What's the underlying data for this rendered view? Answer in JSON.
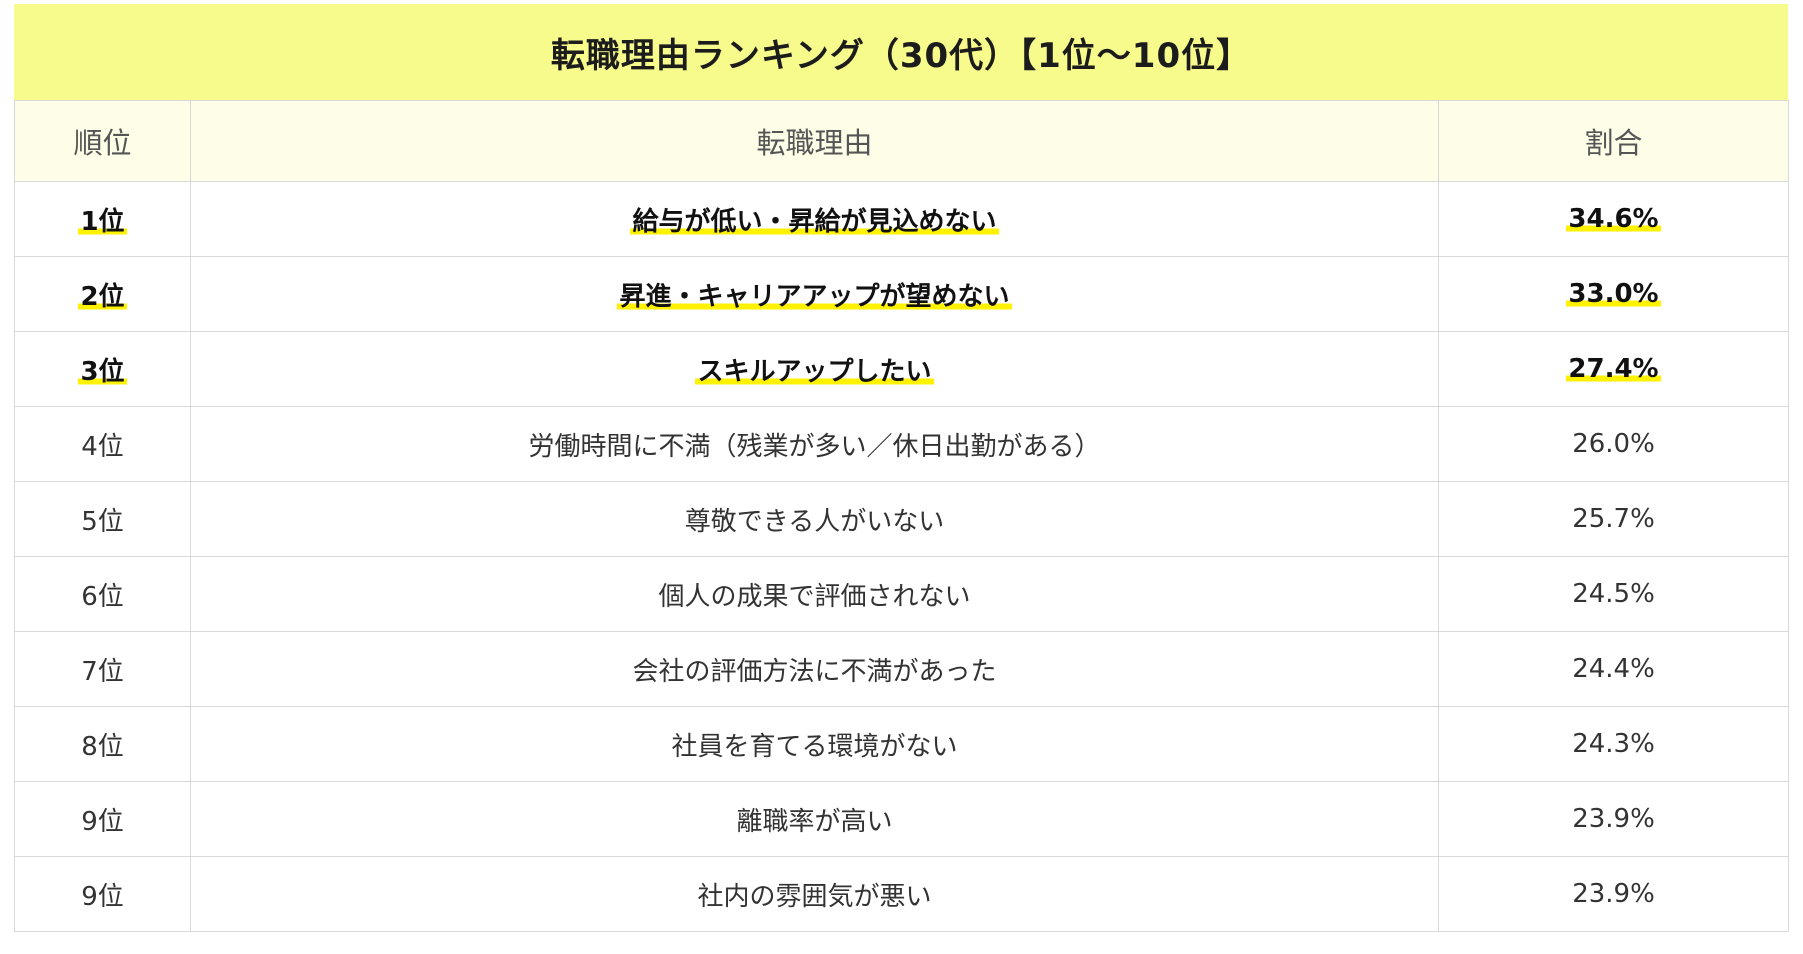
{
  "title": "転職理由ランキング（30代）【1位〜10位】",
  "headers": {
    "rank": "順位",
    "reason": "転職理由",
    "percent": "割合"
  },
  "rows": [
    {
      "rank": "1位",
      "reason": "給与が低い・昇給が見込めない",
      "percent": "34.6%",
      "highlight": true
    },
    {
      "rank": "2位",
      "reason": "昇進・キャリアアップが望めない",
      "percent": "33.0%",
      "highlight": true
    },
    {
      "rank": "3位",
      "reason": "スキルアップしたい",
      "percent": "27.4%",
      "highlight": true
    },
    {
      "rank": "4位",
      "reason": "労働時間に不満（残業が多い／休日出勤がある）",
      "percent": "26.0%",
      "highlight": false
    },
    {
      "rank": "5位",
      "reason": "尊敬できる人がいない",
      "percent": "25.7%",
      "highlight": false
    },
    {
      "rank": "6位",
      "reason": "個人の成果で評価されない",
      "percent": "24.5%",
      "highlight": false
    },
    {
      "rank": "7位",
      "reason": "会社の評価方法に不満があった",
      "percent": "24.4%",
      "highlight": false
    },
    {
      "rank": "8位",
      "reason": "社員を育てる環境がない",
      "percent": "24.3%",
      "highlight": false
    },
    {
      "rank": "9位",
      "reason": "離職率が高い",
      "percent": "23.9%",
      "highlight": false
    },
    {
      "rank": "9位",
      "reason": "社内の雰囲気が悪い",
      "percent": "23.9%",
      "highlight": false
    }
  ],
  "colors": {
    "title_background": "#f7fb8c",
    "header_background": "#fefee8",
    "highlight_marker": "#fff200",
    "border": "#d9d9d9"
  }
}
